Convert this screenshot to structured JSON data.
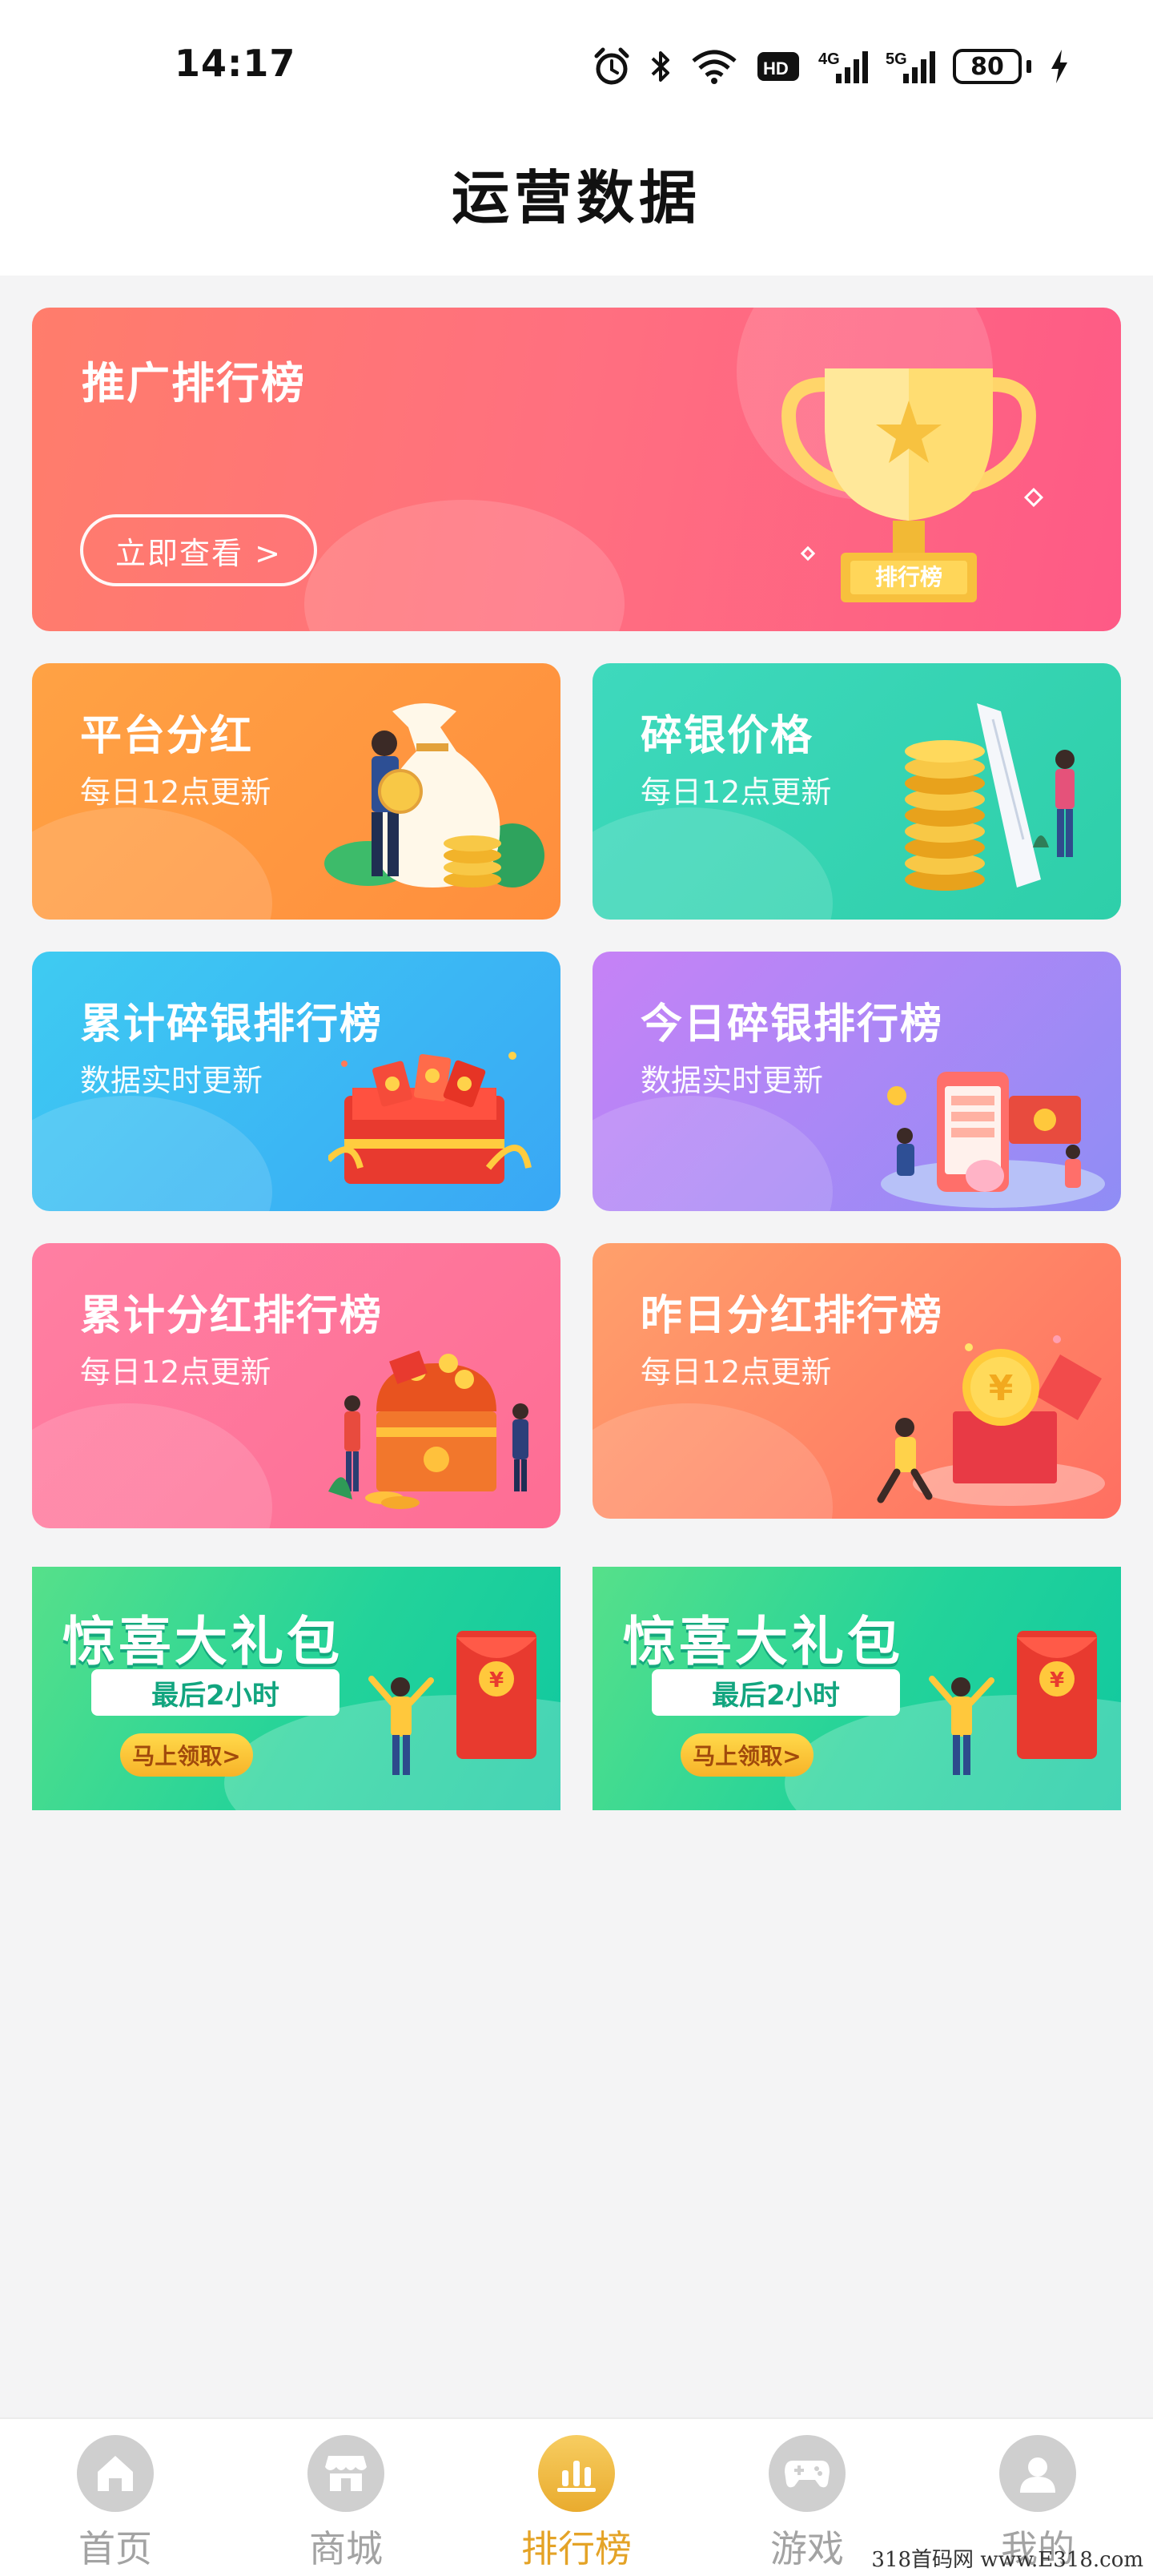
{
  "status_bar": {
    "time": "14:17",
    "battery": "80",
    "hd_label": "HD",
    "network_a": "4G",
    "network_b": "5G"
  },
  "header": {
    "title": "运营数据"
  },
  "hero": {
    "title": "推广排行榜",
    "button": "立即查看 >",
    "trophy_label": "排行榜"
  },
  "cards": [
    {
      "title": "平台分红",
      "subtitle": "每日12点更新"
    },
    {
      "title": "碎银价格",
      "subtitle": "每日12点更新"
    },
    {
      "title": "累计碎银排行榜",
      "subtitle": "数据实时更新"
    },
    {
      "title": "今日碎银排行榜",
      "subtitle": "数据实时更新"
    },
    {
      "title": "累计分红排行榜",
      "subtitle": "每日12点更新"
    },
    {
      "title": "昨日分红排行榜",
      "subtitle": "每日12点更新"
    }
  ],
  "promos": [
    {
      "title": "惊喜大礼包",
      "pill": "最后2小时",
      "button": "马上领取>"
    },
    {
      "title": "惊喜大礼包",
      "pill": "最后2小时",
      "button": "马上领取>"
    }
  ],
  "nav": [
    {
      "label": "首页",
      "icon": "home-icon"
    },
    {
      "label": "商城",
      "icon": "shop-icon"
    },
    {
      "label": "排行榜",
      "icon": "ranking-icon",
      "active": true
    },
    {
      "label": "游戏",
      "icon": "gamepad-icon"
    },
    {
      "label": "我的",
      "icon": "user-icon"
    }
  ],
  "watermark": "318首码网 www.E318.com",
  "colors": {
    "accent": "#e4a327",
    "inactive": "#a3a3a3"
  }
}
